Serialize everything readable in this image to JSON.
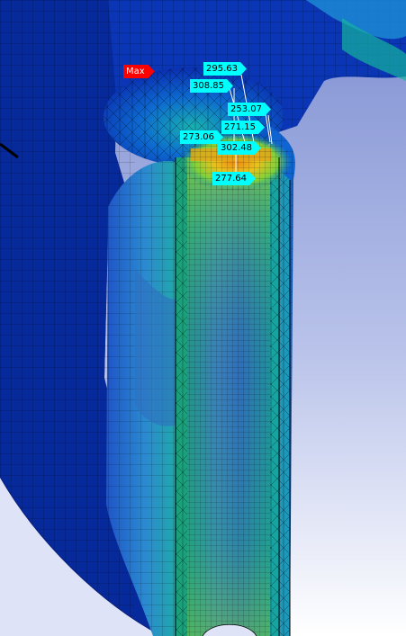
{
  "viewport": {
    "background_top": "#8a99d6",
    "background_bottom": "#ffffff"
  },
  "max_marker": {
    "label": "Max",
    "color": "#ff0000"
  },
  "probes": [
    {
      "id": "probe-1",
      "value": "295.63"
    },
    {
      "id": "probe-2",
      "value": "308.85"
    },
    {
      "id": "probe-3",
      "value": "253.07"
    },
    {
      "id": "probe-4",
      "value": "271.15"
    },
    {
      "id": "probe-5",
      "value": "273.06"
    },
    {
      "id": "probe-6",
      "value": "302.48"
    },
    {
      "id": "probe-7",
      "value": "277.64"
    }
  ],
  "colors": {
    "probe_fill": "#00ffff",
    "mesh_line": "#000000",
    "contour_low": "#001a9e",
    "contour_mid_low": "#0a5ad6",
    "contour_mid": "#11b4a8",
    "contour_high": "#58c846",
    "contour_peak": "#e89a1a"
  }
}
